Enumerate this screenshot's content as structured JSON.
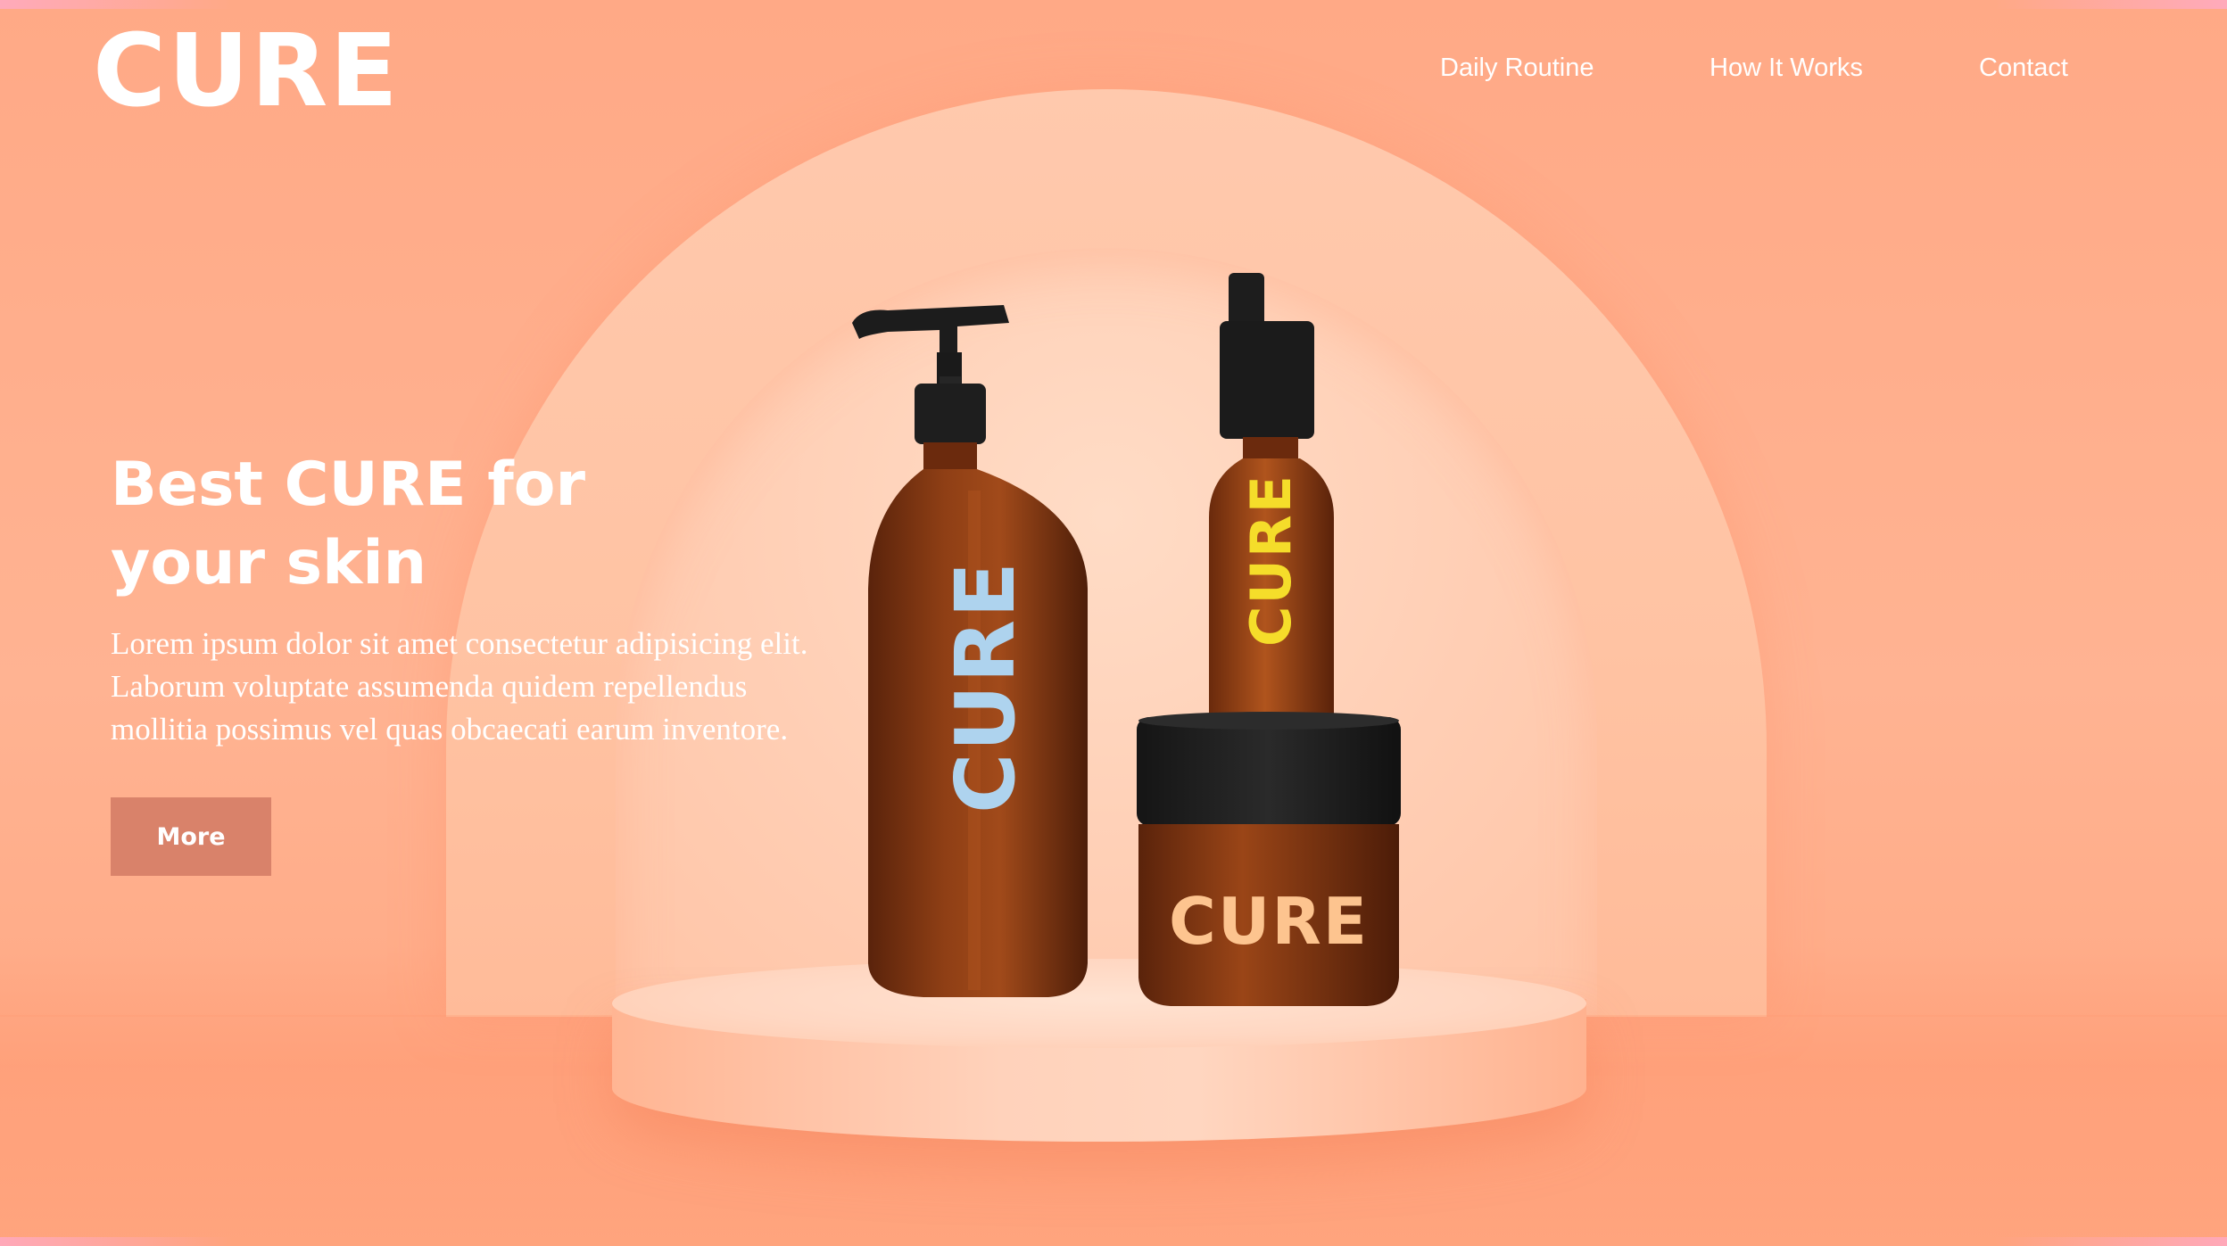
{
  "brand": {
    "logo_text": "CURE"
  },
  "nav": {
    "items": [
      {
        "label": "Daily Routine"
      },
      {
        "label": "How It Works"
      },
      {
        "label": "Contact"
      }
    ]
  },
  "hero": {
    "title_line1": "Best CURE for",
    "title_line2": "your skin",
    "description_lines": [
      "Lorem ipsum dolor sit amet consectetur adipisicing elit.",
      "Laborum voluptate assumenda quidem repellendus",
      "mollitia possimus vel quas obcaecati earum inventore."
    ],
    "cta_label": "More"
  },
  "products": {
    "pump_bottle_label": "CURE",
    "serum_bottle_label": "CURE",
    "jar_label": "CURE"
  },
  "colors": {
    "background": "#ffb08e",
    "button": "#d9826a",
    "bottle_glass": "#8a3a12",
    "cap": "#1e1e1e",
    "pump_label": "#aed3ee",
    "serum_label": "#f5dd2a",
    "jar_label": "#fdc48f",
    "text": "#ffffff"
  }
}
